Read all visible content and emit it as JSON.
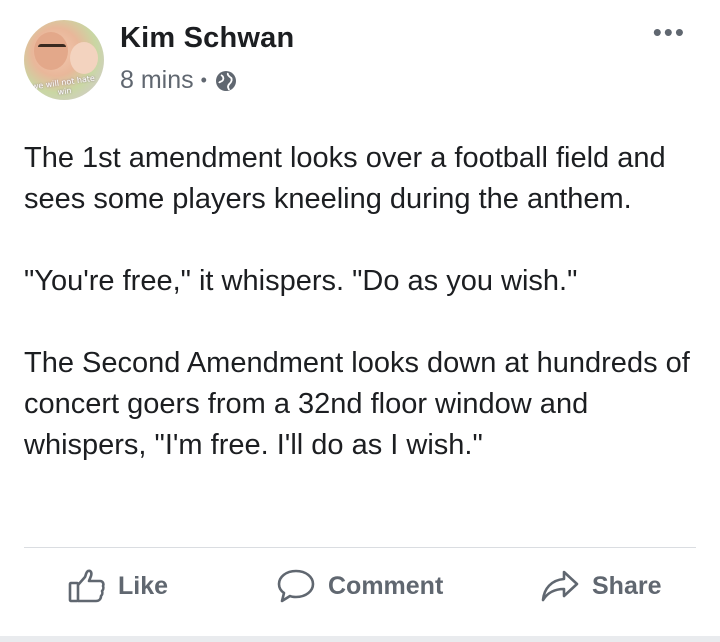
{
  "post": {
    "author": "Kim Schwan",
    "time": "8 mins",
    "separator": "•",
    "privacy_icon": "globe-icon",
    "more_label": "•••",
    "avatar_overlay_text": "we will not hate win",
    "paragraphs": [
      "The 1st amendment looks over a football field and sees some players kneeling during the anthem.",
      "\"You're free,\" it whispers. \"Do as you wish.\"",
      "The Second Amendment looks down at hundreds of concert goers from a 32nd floor window and whispers, \"I'm free. I'll do as I wish.\""
    ]
  },
  "actions": {
    "like_label": "Like",
    "comment_label": "Comment",
    "share_label": "Share",
    "like_icon": "thumbs-up-icon",
    "comment_icon": "comment-bubble-icon",
    "share_icon": "share-arrow-icon"
  },
  "colors": {
    "text": "#1c1e21",
    "secondary": "#606770",
    "divider": "#dadde1"
  }
}
